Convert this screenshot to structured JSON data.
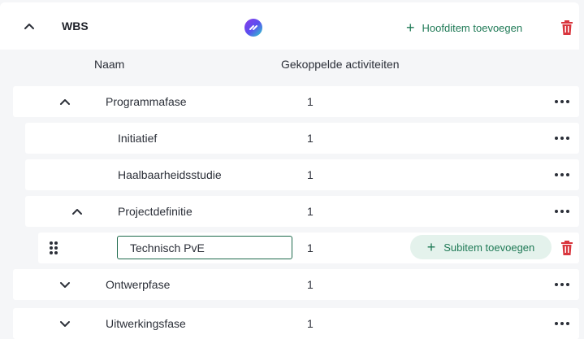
{
  "header": {
    "title": "WBS",
    "chevron_icon": "chevron-up-icon",
    "logo_icon": "app-logo-icon",
    "add_main_label": "Hoofditem toevoegen",
    "add_icon": "plus-icon",
    "delete_icon": "trash-icon",
    "accent_color": "#1f7a56",
    "danger_color": "#d9363e"
  },
  "columns": {
    "name": "Naam",
    "activities": "Gekoppelde activiteiten"
  },
  "rows": [
    {
      "label": "Programmafase",
      "count": "1",
      "expanded": true,
      "level": 0
    },
    {
      "label": "Initiatief",
      "count": "1",
      "level": 1
    },
    {
      "label": "Haalbaarheidsstudie",
      "count": "1",
      "level": 1
    },
    {
      "label": "Projectdefinitie",
      "count": "1",
      "expanded": true,
      "level": 1
    },
    {
      "label": "Technisch PvE",
      "count": "1",
      "level": 2,
      "editing": true,
      "add_sub_label": "Subitem toevoegen"
    },
    {
      "label": "Ontwerpfase",
      "count": "1",
      "expanded": false,
      "level": 0
    },
    {
      "label": "Uitwerkingsfase",
      "count": "1",
      "expanded": false,
      "level": 0
    }
  ]
}
